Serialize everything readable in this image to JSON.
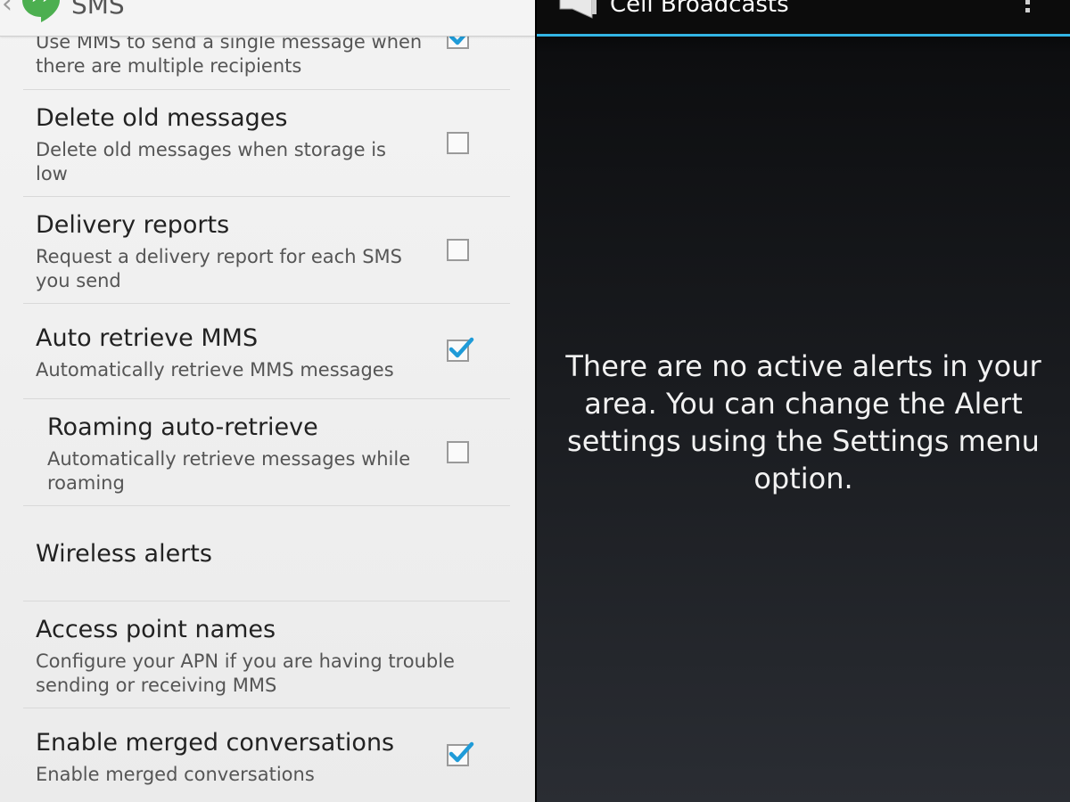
{
  "left_panel": {
    "title": "SMS",
    "items": [
      {
        "summary": "Use MMS to send a single message when there are multiple recipients",
        "checked": true
      },
      {
        "title": "Delete old messages",
        "summary": "Delete old messages when storage is low",
        "checked": false
      },
      {
        "title": "Delivery reports",
        "summary": "Request a delivery report for each SMS you send",
        "checked": false
      },
      {
        "title": "Auto retrieve MMS",
        "summary": "Automatically retrieve MMS messages",
        "checked": true
      },
      {
        "title": "Roaming auto-retrieve",
        "summary": "Automatically retrieve messages while roaming",
        "checked": false
      },
      {
        "title": "Wireless alerts"
      },
      {
        "title": "Access point names",
        "summary": "Configure your APN if you are having trouble sending or receiving MMS"
      },
      {
        "title": "Enable merged conversations",
        "summary": "Enable merged conversations",
        "checked": true
      }
    ]
  },
  "right_panel": {
    "title": "Cell Broadcasts",
    "empty_message": "There are no active alerts in your area. You can change the Alert settings using the Settings menu option."
  },
  "colors": {
    "accent": "#33b5e5",
    "checkmark": "#1f9bd8",
    "hangouts_green": "#4caf50"
  },
  "icons": {
    "app": "hangouts-icon",
    "megaphone": "megaphone-icon",
    "overflow": "overflow-menu-icon",
    "back": "back-caret-icon"
  }
}
